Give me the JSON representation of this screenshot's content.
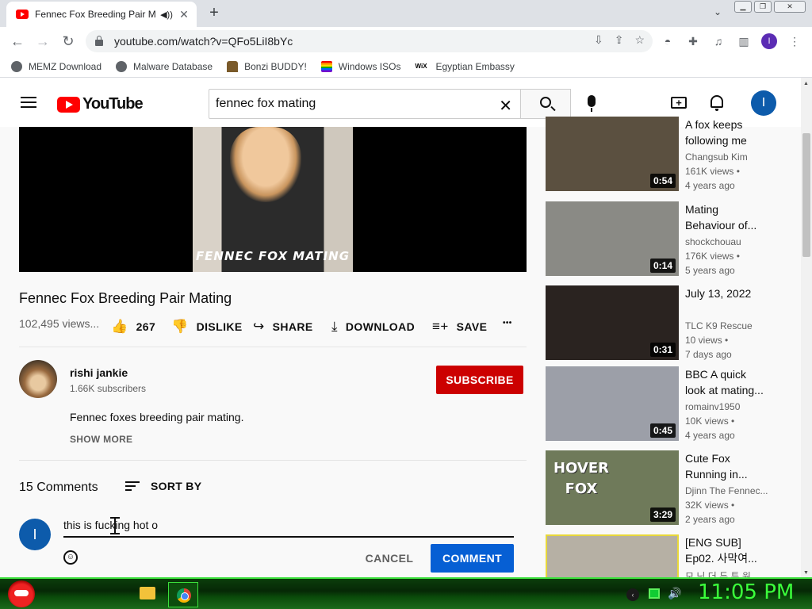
{
  "browser": {
    "tab_title": "Fennec Fox Breeding Pair Ma",
    "audio_icon": "speaker-icon",
    "close_glyph": "✕",
    "new_tab_glyph": "+",
    "tab_menu_glyph": "⌄",
    "url": "youtube.com/watch?v=QFo5LiI8bYc",
    "profile_initial": "I",
    "bookmarks": [
      {
        "label": "MEMZ Download",
        "icon": "globe-icon"
      },
      {
        "label": "Malware Database",
        "icon": "globe-icon"
      },
      {
        "label": "Bonzi BUDDY!",
        "icon": "bonzi-icon"
      },
      {
        "label": "Windows ISOs",
        "icon": "windows-flag-icon"
      },
      {
        "label": "Egyptian Embassy",
        "icon": "wix-icon"
      }
    ],
    "wix_text": "WiX"
  },
  "youtube": {
    "logo_text": "YouTube",
    "search_value": "fennec fox mating",
    "clear_glyph": "✕",
    "user_initial": "I",
    "create_glyph": "+"
  },
  "player": {
    "caption": "FENNEC FOX MATING"
  },
  "video": {
    "title": "Fennec Fox Breeding Pair Mating",
    "views": "102,495 views...",
    "likes": "267",
    "dislike_label": "DISLIKE",
    "share_label": "SHARE",
    "download_label": "DOWNLOAD",
    "save_label": "SAVE",
    "more_glyph": "•••"
  },
  "channel": {
    "name": "rishi jankie",
    "subscribers": "1.66K subscribers",
    "subscribe_label": "SUBSCRIBE",
    "description": "Fennec foxes breeding pair mating.",
    "show_more": "SHOW MORE"
  },
  "comments": {
    "count": "15 Comments",
    "sort_label": "SORT BY",
    "draft": "this is fucking hot o",
    "cancel_label": "CANCEL",
    "submit_label": "COMMENT"
  },
  "sidebar": {
    "items": [
      {
        "title_lines": [
          "A fox keeps",
          "following me"
        ],
        "channel": "Changsub Kim",
        "views": "161K views •",
        "age": "4 years ago",
        "duration": "0:54",
        "thumb": "#5b5040"
      },
      {
        "title_lines": [
          "Mating",
          "Behaviour of..."
        ],
        "channel": "shockchouau",
        "views": "176K views •",
        "age": "5 years ago",
        "duration": "0:14",
        "thumb": "#8a8a85"
      },
      {
        "title_lines": [
          "July 13, 2022"
        ],
        "channel": "TLC K9 Rescue",
        "views": "10 views •",
        "age": "7 days ago",
        "duration": "0:31",
        "thumb": "#2a2320"
      },
      {
        "title_lines": [
          "BBC A quick",
          "look at mating..."
        ],
        "channel": "romainv1950",
        "views": "10K views •",
        "age": "4 years ago",
        "duration": "0:45",
        "thumb": "#9c9fa8"
      },
      {
        "title_lines": [
          "Cute Fox",
          "Running in..."
        ],
        "channel": "Djinn The Fennec...",
        "views": "32K views •",
        "age": "2 years ago",
        "duration": "3:29",
        "thumb": "#6f7a5a",
        "overlay_lines": [
          "HOVER",
          "FOX"
        ]
      },
      {
        "title_lines": [
          "[ENG SUB]",
          "Ep02. 사막여..."
        ],
        "channel": "모 닝 더 듀 투 원",
        "views": "",
        "age": "",
        "duration": "",
        "thumb": "#b6b0a4"
      }
    ]
  },
  "taskbar": {
    "clock": "11:05 PM",
    "tray_glyph": "‹",
    "volume_glyph": "🔊"
  },
  "colors": {
    "yt_red": "#ff0000",
    "subscribe_red": "#cc0000",
    "comment_blue": "#065fd4",
    "taskbar_green": "#3bff3b"
  }
}
